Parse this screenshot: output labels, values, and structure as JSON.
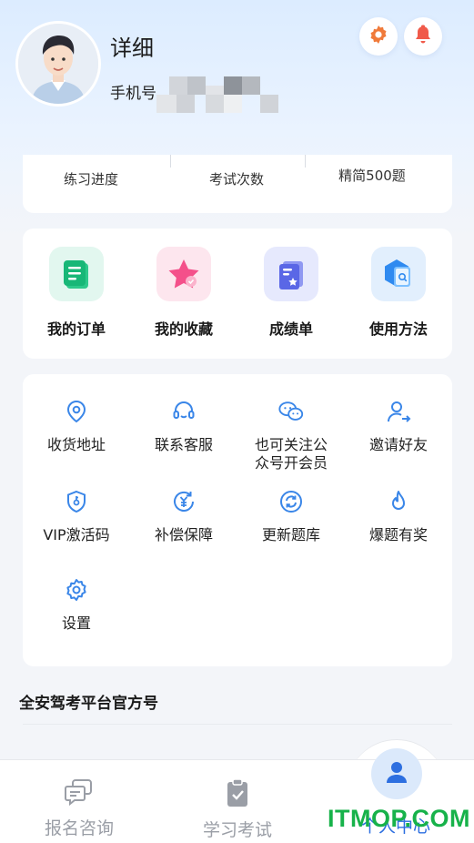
{
  "profile": {
    "name": "详细",
    "phone_label": "手机号"
  },
  "header_icons": [
    "settings-gear-icon",
    "notification-bell-icon"
  ],
  "stats": {
    "items": [
      "练习进度",
      "考试次数",
      "精简500题"
    ]
  },
  "quick_actions": [
    {
      "label": "我的订单",
      "icon": "order-icon"
    },
    {
      "label": "我的收藏",
      "icon": "favorite-star-icon"
    },
    {
      "label": "成绩单",
      "icon": "report-card-icon"
    },
    {
      "label": "使用方法",
      "icon": "usage-guide-icon"
    }
  ],
  "services": [
    {
      "label": "收货地址",
      "icon": "location-pin-icon"
    },
    {
      "label": "联系客服",
      "icon": "headset-icon"
    },
    {
      "label": "也可关注公\n众号开会员",
      "line1": "也可关注公",
      "line2": "众号开会员",
      "icon": "wechat-icon"
    },
    {
      "label": "邀请好友",
      "icon": "invite-user-icon"
    },
    {
      "label": "VIP激活码",
      "icon": "shield-key-icon"
    },
    {
      "label": "补偿保障",
      "icon": "yen-refresh-icon"
    },
    {
      "label": "更新题库",
      "icon": "refresh-icon"
    },
    {
      "label": "爆题有奖",
      "icon": "flame-icon"
    },
    {
      "label": "设置",
      "icon": "gear-icon"
    }
  ],
  "section": {
    "title": "全安驾考平台官方号"
  },
  "tabs": [
    {
      "label": "报名咨询",
      "icon": "chat-icon"
    },
    {
      "label": "学习考试",
      "icon": "clipboard-icon"
    },
    {
      "label": "个人中心",
      "icon": "user-icon",
      "active": true
    }
  ],
  "watermark": "ITMOP.COM",
  "colors": {
    "accent": "#2d6fe0",
    "icon_blue": "#3a86e8",
    "settings_orange": "#f07a3a",
    "bell_red": "#f05a4a",
    "watermark_green": "#17b24a"
  }
}
